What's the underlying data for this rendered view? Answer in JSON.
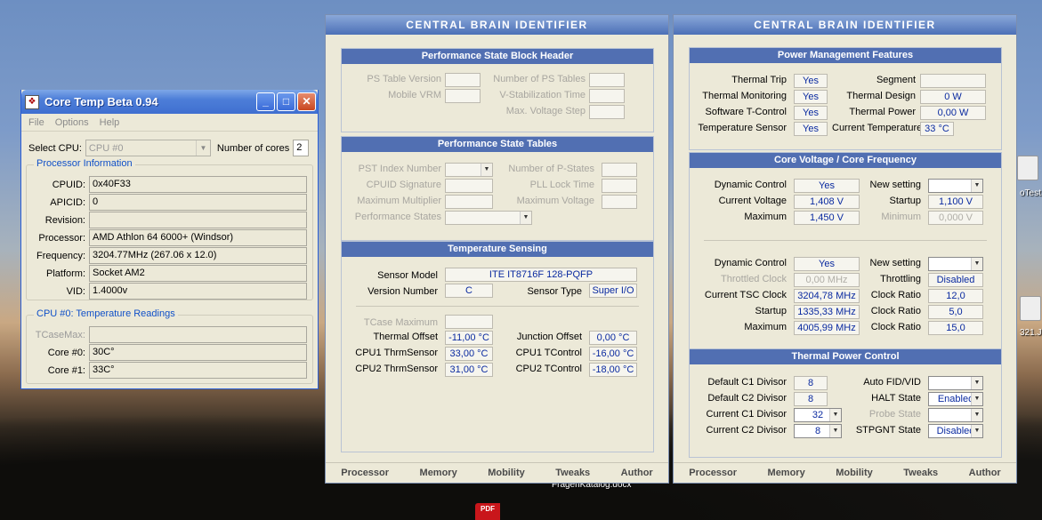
{
  "desktop": {
    "labels": [
      "oTest.",
      "321.J",
      "FragenKatalog.docx"
    ],
    "pdf_label": "PDF"
  },
  "coretemp": {
    "title": "Core Temp Beta 0.94",
    "menu": [
      "File",
      "Options",
      "Help"
    ],
    "select_cpu_label": "Select CPU:",
    "select_cpu_value": "CPU #0",
    "num_cores_label": "Number of cores",
    "num_cores_value": "2",
    "proc_info_title": "Processor Information",
    "rows": [
      {
        "label": "CPUID:",
        "value": "0x40F33"
      },
      {
        "label": "APICID:",
        "value": "0"
      },
      {
        "label": "Revision:",
        "value": ""
      },
      {
        "label": "Processor:",
        "value": "AMD Athlon 64 6000+ (Windsor)"
      },
      {
        "label": "Frequency:",
        "value": "3204.77MHz (267.06 x 12.0)"
      },
      {
        "label": "Platform:",
        "value": "Socket AM2"
      },
      {
        "label": "VID:",
        "value": "1.4000v"
      }
    ],
    "temp_title": "CPU #0: Temperature Readings",
    "temps": [
      {
        "label": "TCaseMax:",
        "value": ""
      },
      {
        "label": "Core #0:",
        "value": "30C°"
      },
      {
        "label": "Core #1:",
        "value": "33C°"
      }
    ]
  },
  "cbi_left": {
    "title": "CENTRAL BRAIN IDENTIFIER",
    "ps_header": {
      "title": "Performance State Block Header",
      "left": [
        {
          "label": "PS Table Version",
          "value": ""
        },
        {
          "label": "Mobile VRM",
          "value": ""
        }
      ],
      "right": [
        {
          "label": "Number of PS Tables",
          "value": ""
        },
        {
          "label": "V-Stabilization Time",
          "value": ""
        },
        {
          "label": "Max. Voltage Step",
          "value": ""
        }
      ]
    },
    "ps_tables": {
      "title": "Performance State Tables",
      "left": [
        {
          "label": "PST Index Number",
          "value": ""
        },
        {
          "label": "CPUID Signature",
          "value": ""
        },
        {
          "label": "Maximum Multiplier",
          "value": ""
        },
        {
          "label": "Performance States",
          "value": ""
        }
      ],
      "right": [
        {
          "label": "Number of P-States",
          "value": ""
        },
        {
          "label": "PLL Lock Time",
          "value": ""
        },
        {
          "label": "Maximum Voltage",
          "value": ""
        }
      ]
    },
    "temp": {
      "title": "Temperature Sensing",
      "sensor_model_label": "Sensor Model",
      "sensor_model": "ITE IT8716F 128-PQFP",
      "version_label": "Version Number",
      "version": "C",
      "sensor_type_label": "Sensor Type",
      "sensor_type": "Super I/O",
      "tcase_label": "TCase Maximum",
      "tcase": "",
      "left": [
        {
          "label": "Thermal Offset",
          "value": "-11,00 °C"
        },
        {
          "label": "CPU1 ThrmSensor",
          "value": "33,00 °C"
        },
        {
          "label": "CPU2 ThrmSensor",
          "value": "31,00 °C"
        }
      ],
      "right": [
        {
          "label": "Junction Offset",
          "value": "0,00 °C"
        },
        {
          "label": "CPU1 TControl",
          "value": "-16,00 °C"
        },
        {
          "label": "CPU2 TControl",
          "value": "-18,00 °C"
        }
      ]
    },
    "tabs": [
      "Processor",
      "Memory",
      "Mobility",
      "Tweaks",
      "Author"
    ]
  },
  "cbi_right": {
    "title": "CENTRAL BRAIN IDENTIFIER",
    "pm": {
      "title": "Power Management Features",
      "left": [
        {
          "label": "Thermal Trip",
          "value": "Yes"
        },
        {
          "label": "Thermal Monitoring",
          "value": "Yes"
        },
        {
          "label": "Software T-Control",
          "value": "Yes"
        },
        {
          "label": "Temperature Sensor",
          "value": "Yes"
        }
      ],
      "right": [
        {
          "label": "Segment",
          "value": ""
        },
        {
          "label": "Thermal Design",
          "value": "0 W"
        },
        {
          "label": "Thermal Power",
          "value": "0,00 W"
        },
        {
          "label": "Current Temperature",
          "value": "33 °C"
        }
      ]
    },
    "cv": {
      "title": "Core Voltage / Core Frequency",
      "volt_left": [
        {
          "label": "Dynamic Control",
          "value": "Yes"
        },
        {
          "label": "Current Voltage",
          "value": "1,408 V"
        },
        {
          "label": "Maximum",
          "value": "1,450 V"
        }
      ],
      "volt_right": [
        {
          "label": "New setting",
          "value": ""
        },
        {
          "label": "Startup",
          "value": "1,100 V"
        },
        {
          "label": "Minimum",
          "value": "0,000 V"
        }
      ],
      "freq_left": [
        {
          "label": "Dynamic Control",
          "value": "Yes"
        },
        {
          "label": "Throttled Clock",
          "value": "0,00 MHz"
        },
        {
          "label": "Current TSC Clock",
          "value": "3204,78 MHz"
        },
        {
          "label": "Startup",
          "value": "1335,33 MHz"
        },
        {
          "label": "Maximum",
          "value": "4005,99 MHz"
        }
      ],
      "freq_right": [
        {
          "label": "New setting",
          "value": ""
        },
        {
          "label": "Throttling",
          "value": "Disabled"
        },
        {
          "label": "Clock Ratio",
          "value": "12,0"
        },
        {
          "label": "Clock Ratio",
          "value": "5,0"
        },
        {
          "label": "Clock Ratio",
          "value": "15,0"
        }
      ]
    },
    "tp": {
      "title": "Thermal Power Control",
      "left": [
        {
          "label": "Default C1 Divisor",
          "value": "8"
        },
        {
          "label": "Default C2 Divisor",
          "value": "8"
        },
        {
          "label": "Current C1 Divisor",
          "value": "32"
        },
        {
          "label": "Current C2 Divisor",
          "value": "8"
        }
      ],
      "right": [
        {
          "label": "Auto FID/VID",
          "value": ""
        },
        {
          "label": "HALT State",
          "value": "Enabled"
        },
        {
          "label": "Probe State",
          "value": ""
        },
        {
          "label": "STPGNT State",
          "value": "Disabled"
        }
      ]
    },
    "tabs": [
      "Processor",
      "Memory",
      "Mobility",
      "Tweaks",
      "Author"
    ]
  }
}
